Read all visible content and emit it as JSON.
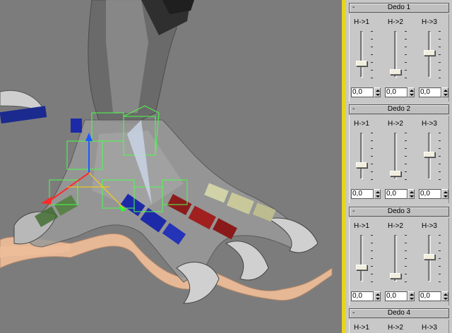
{
  "panel": {
    "rollouts": [
      {
        "title": "Dedo 1",
        "collapse_symbol": "-",
        "controls": [
          {
            "label": "H->1",
            "value": "0,0",
            "level": 0.3
          },
          {
            "label": "H->2",
            "value": "0,0",
            "level": 0.1
          },
          {
            "label": "H->3",
            "value": "0,0",
            "level": 0.55
          }
        ]
      },
      {
        "title": "Dedo 2",
        "collapse_symbol": "-",
        "controls": [
          {
            "label": "H->1",
            "value": "0,0",
            "level": 0.3
          },
          {
            "label": "H->2",
            "value": "0,0",
            "level": 0.1
          },
          {
            "label": "H->3",
            "value": "0,0",
            "level": 0.55
          }
        ]
      },
      {
        "title": "Dedo 3",
        "collapse_symbol": "-",
        "controls": [
          {
            "label": "H->1",
            "value": "0,0",
            "level": 0.3
          },
          {
            "label": "H->2",
            "value": "0,0",
            "level": 0.1
          },
          {
            "label": "H->3",
            "value": "0,0",
            "level": 0.55
          }
        ]
      },
      {
        "title": "Dedo 4",
        "collapse_symbol": "-",
        "controls": [
          {
            "label": "H->1"
          },
          {
            "label": "H->2"
          },
          {
            "label": "H->3"
          }
        ]
      }
    ]
  },
  "colors": {
    "viewport_bg": "#7c7c7c",
    "divider": "#e8d51c",
    "panel_bg": "#c8c8c8",
    "thumb": "#f1eedd"
  }
}
